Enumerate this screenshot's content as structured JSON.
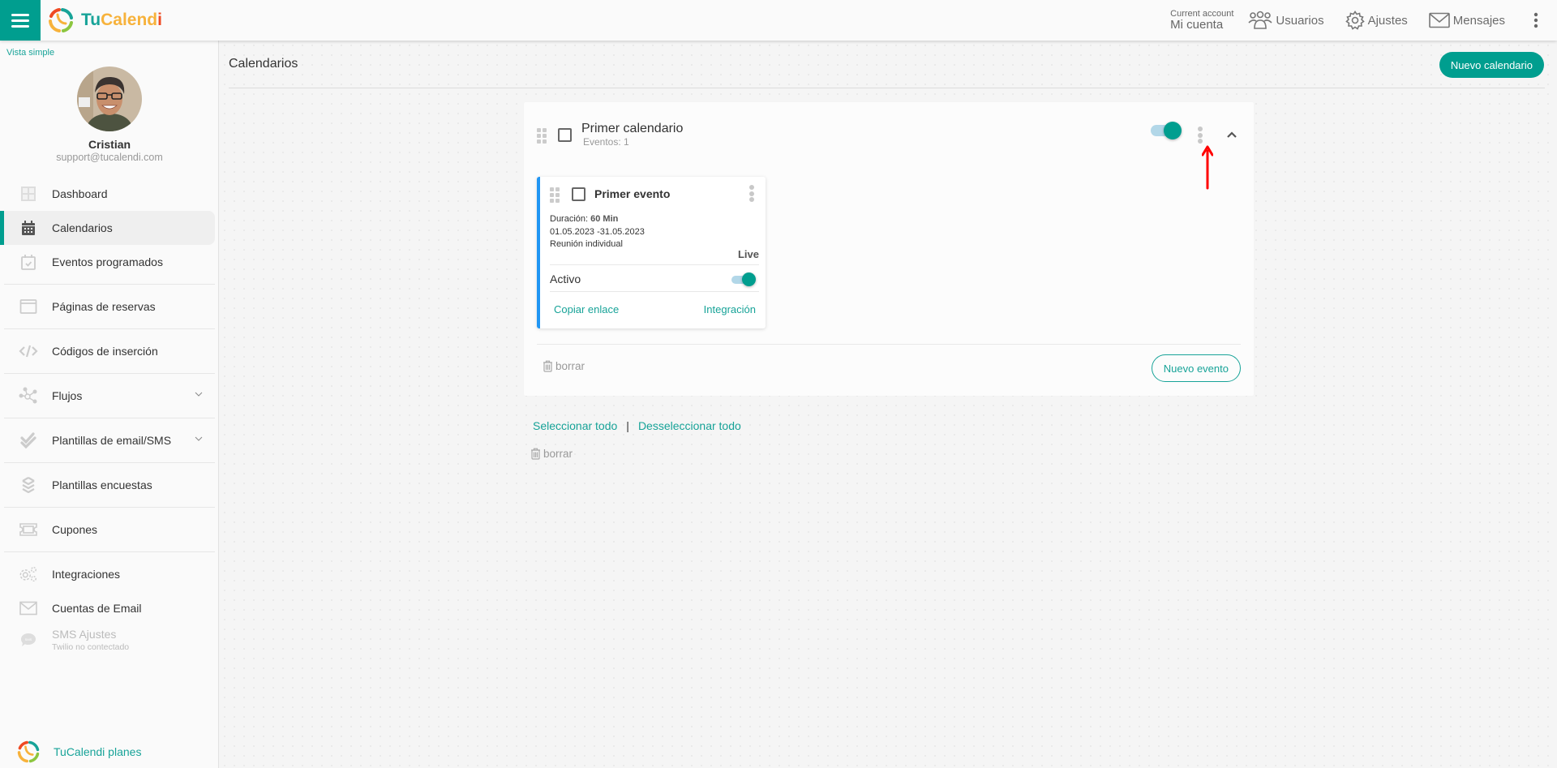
{
  "header": {
    "menu_icon": "hamburger-icon",
    "logo": {
      "part1": "Tu",
      "part2": "Calend",
      "part3": "i",
      "colors": {
        "teal": "#17a398",
        "yellow": "#f7b23b",
        "red": "#ef4a23",
        "green": "#8cc63f"
      }
    },
    "account_label": "Current account",
    "account_value": "Mi cuenta",
    "links": [
      {
        "label": "Usuarios",
        "icon": "users-icon"
      },
      {
        "label": "Ajustes",
        "icon": "gear-icon"
      },
      {
        "label": "Mensajes",
        "icon": "envelope-icon"
      }
    ],
    "more_icon": "kebab-menu-icon"
  },
  "sidebar": {
    "view_toggle": "Vista simple",
    "user": {
      "name": "Cristian",
      "email": "support@tucalendi.com"
    },
    "items": [
      {
        "label": "Dashboard",
        "icon": "dashboard-icon"
      },
      {
        "label": "Calendarios",
        "icon": "calendar-icon",
        "active": true
      },
      {
        "label": "Eventos programados",
        "icon": "calendar-check-icon"
      },
      {
        "label": "Páginas de reservas",
        "icon": "browser-window-icon"
      },
      {
        "label": "Códigos de inserción",
        "icon": "code-icon"
      },
      {
        "label": "Flujos",
        "icon": "flow-icon",
        "expandable": true
      },
      {
        "label": "Plantillas de email/SMS",
        "icon": "double-check-icon",
        "expandable": true
      },
      {
        "label": "Plantillas encuestas",
        "icon": "layers-icon"
      },
      {
        "label": "Cupones",
        "icon": "ticket-icon"
      },
      {
        "label": "Integraciones",
        "icon": "gears-icon"
      },
      {
        "label": "Cuentas de Email",
        "icon": "envelope-icon"
      },
      {
        "label": "SMS Ajustes",
        "sublabel": "Twilio no contectado",
        "icon": "sms-icon",
        "disabled": true
      }
    ],
    "plans_label": "TuCalendi planes"
  },
  "main": {
    "title": "Calendarios",
    "new_calendar_label": "Nuevo calendario",
    "calendar": {
      "title": "Primer calendario",
      "events_count": "Eventos: 1",
      "enabled": true,
      "event": {
        "title": "Primer evento",
        "duration_label": "Duración:",
        "duration_value": "60 Min",
        "date_range": "01.05.2023 -31.05.2023",
        "type": "Reunión individual",
        "status": "Live",
        "active_label": "Activo",
        "active": true,
        "copy_link_label": "Copiar enlace",
        "integration_label": "Integración"
      },
      "delete_label": "borrar",
      "new_event_label": "Nuevo evento"
    },
    "select_all_label": "Seleccionar todo",
    "separator": "|",
    "deselect_all_label": "Desseleccionar todo",
    "bulk_delete_label": "borrar"
  },
  "colors": {
    "accent": "#009e8f",
    "link": "#17a398",
    "event_border": "#2196f3",
    "annotation_arrow": "#ff0000"
  }
}
